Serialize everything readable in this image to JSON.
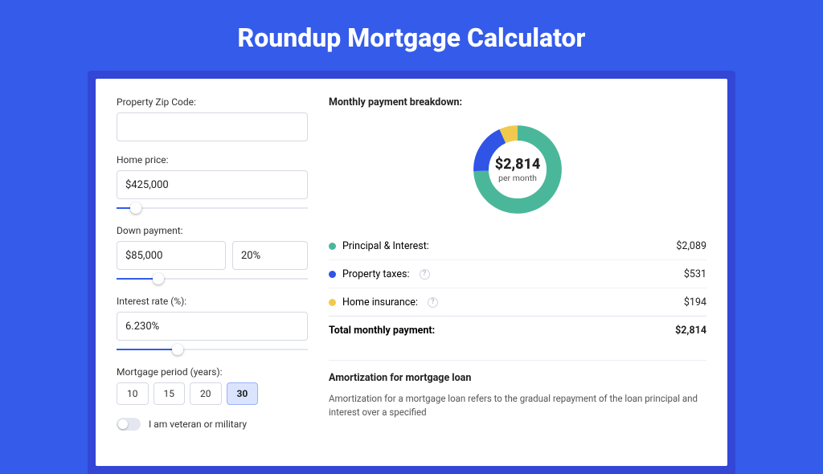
{
  "header": {
    "title": "Roundup Mortgage Calculator"
  },
  "form": {
    "zip_label": "Property Zip Code:",
    "zip_value": "",
    "price_label": "Home price:",
    "price_value": "$425,000",
    "price_slider_pct": 10,
    "down_label": "Down payment:",
    "down_value": "$85,000",
    "down_pct_value": "20%",
    "down_slider_pct": 22,
    "rate_label": "Interest rate (%):",
    "rate_value": "6.230%",
    "rate_slider_pct": 32,
    "period_label": "Mortgage period (years):",
    "periods": [
      {
        "label": "10",
        "active": false
      },
      {
        "label": "15",
        "active": false
      },
      {
        "label": "20",
        "active": false
      },
      {
        "label": "30",
        "active": true
      }
    ],
    "vet_label": "I am veteran or military",
    "vet_on": false
  },
  "breakdown": {
    "section_label": "Monthly payment breakdown:",
    "donut_amount": "$2,814",
    "donut_sub": "per month",
    "rows": [
      {
        "color": "#4bb79a",
        "label": "Principal & Interest:",
        "info": false,
        "value": "$2,089"
      },
      {
        "color": "#2f54e6",
        "label": "Property taxes:",
        "info": true,
        "value": "$531"
      },
      {
        "color": "#f0c94e",
        "label": "Home insurance:",
        "info": true,
        "value": "$194"
      }
    ],
    "total_label": "Total monthly payment:",
    "total_value": "$2,814"
  },
  "amort": {
    "title": "Amortization for mortgage loan",
    "body": "Amortization for a mortgage loan refers to the gradual repayment of the loan principal and interest over a specified"
  },
  "chart_data": {
    "type": "pie",
    "title": "Monthly payment breakdown",
    "series": [
      {
        "name": "Principal & Interest",
        "value": 2089,
        "color": "#4bb79a"
      },
      {
        "name": "Property taxes",
        "value": 531,
        "color": "#2f54e6"
      },
      {
        "name": "Home insurance",
        "value": 194,
        "color": "#f0c94e"
      }
    ],
    "total": 2814,
    "center_label": "$2,814",
    "center_sublabel": "per month",
    "donut": true
  }
}
